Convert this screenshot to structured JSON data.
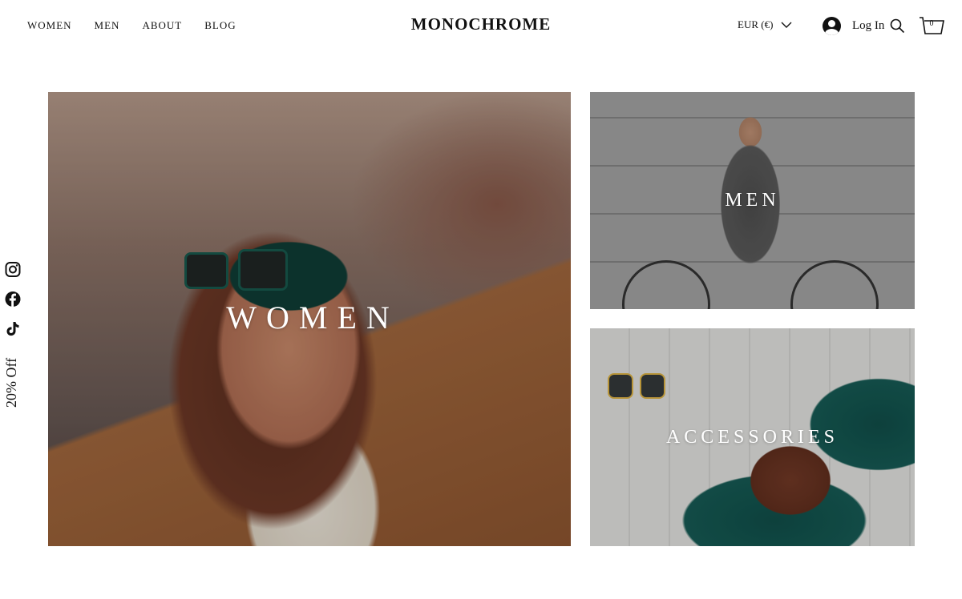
{
  "header": {
    "nav": [
      "WOMEN",
      "MEN",
      "ABOUT",
      "BLOG"
    ],
    "logo": "MONOCHROME",
    "currency": "EUR (€)",
    "login_label": "Log In",
    "cart_count": "0"
  },
  "sidebar": {
    "social": [
      "instagram-icon",
      "facebook-icon",
      "tiktok-icon"
    ],
    "promo": "20% Off"
  },
  "tiles": {
    "women": "WOMEN",
    "men": "MEN",
    "accessories": "ACCESSORIES"
  },
  "colors": {
    "text": "#111111",
    "background": "#ffffff",
    "tile_text": "#ffffff"
  }
}
